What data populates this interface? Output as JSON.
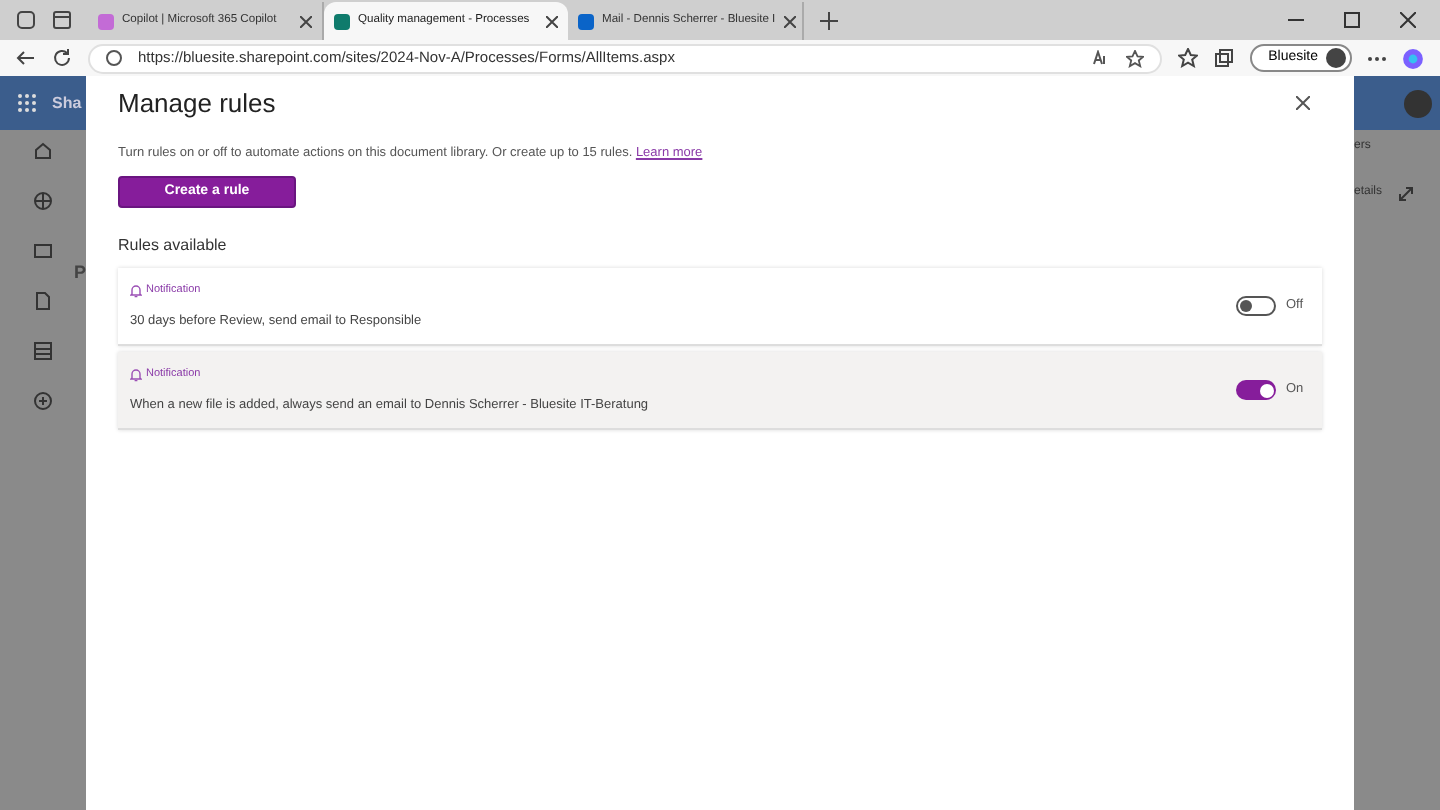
{
  "browser": {
    "tabs": [
      {
        "title": "Copilot | Microsoft 365 Copilot",
        "selected": false
      },
      {
        "title": "Quality management - Processes",
        "selected": true
      },
      {
        "title": "Mail - Dennis Scherrer - Bluesite I",
        "selected": false
      }
    ],
    "url": "https://bluesite.sharepoint.com/sites/2024-Nov-A/Processes/Forms/AllItems.aspx",
    "profile": "Bluesite"
  },
  "background": {
    "site_title": "Sha",
    "heading": "P",
    "toolbar_text": "ers",
    "details": "etails"
  },
  "panel": {
    "title": "Manage rules",
    "description": "Turn rules on or off to automate actions on this document library. Or create up to 15 rules.",
    "link": "Learn more",
    "create_button": "Create a rule",
    "section_title": "Rules available",
    "rules": [
      {
        "type": "Notification",
        "text": "30 days before Review, send email to Responsible",
        "on": false,
        "state_label": "Off",
        "highlighted": false
      },
      {
        "type": "Notification",
        "text": "When a new file is added, always send an email to Dennis Scherrer - Bluesite IT-Beratung",
        "on": true,
        "state_label": "On",
        "highlighted": true
      }
    ]
  }
}
